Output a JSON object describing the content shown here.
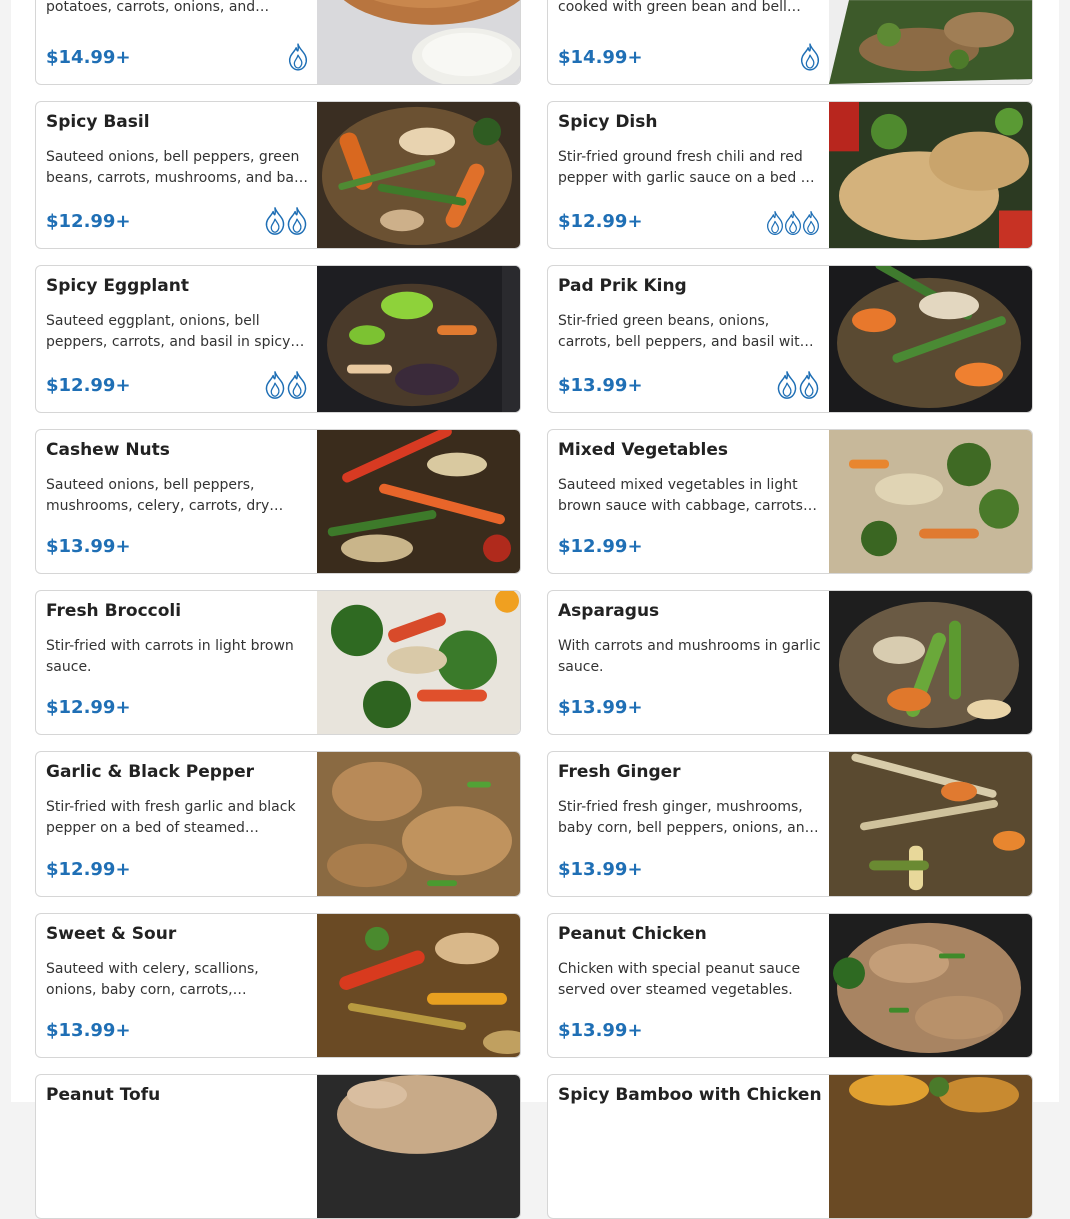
{
  "accent_color": "#1f6fb5",
  "items": [
    {
      "title": "",
      "desc": "potatoes, carrots, onions, and…",
      "price": "$14.99+",
      "spice": 1,
      "photo": "curry-with-rice"
    },
    {
      "title": "",
      "desc": "cooked with green bean and bell…",
      "price": "$14.99+",
      "spice": 1,
      "photo": "chicken-green-curry"
    },
    {
      "title": "Spicy Basil",
      "desc": "Sauteed onions, bell peppers, green beans, carrots, mushrooms, and ba…",
      "price": "$12.99+",
      "spice": 2,
      "photo": "spicy-basil"
    },
    {
      "title": "Spicy Dish",
      "desc": "Stir-fried ground fresh chili and red pepper with garlic sauce on a bed …",
      "price": "$12.99+",
      "spice": 3,
      "photo": "spicy-dish"
    },
    {
      "title": "Spicy Eggplant",
      "desc": "Sauteed eggplant, onions, bell peppers, carrots, and basil in spicy…",
      "price": "$12.99+",
      "spice": 2,
      "photo": "spicy-eggplant"
    },
    {
      "title": "Pad Prik King",
      "desc": "Stir-fried green beans, onions, carrots, bell peppers, and basil wit…",
      "price": "$13.99+",
      "spice": 2,
      "photo": "pad-prik-king"
    },
    {
      "title": "Cashew Nuts",
      "desc": "Sauteed onions, bell peppers, mushrooms, celery, carrots, dry…",
      "price": "$13.99+",
      "spice": 0,
      "photo": "cashew-nuts"
    },
    {
      "title": "Mixed Vegetables",
      "desc": "Sauteed mixed vegetables in light brown sauce with cabbage, carrots…",
      "price": "$12.99+",
      "spice": 0,
      "photo": "mixed-vegetables"
    },
    {
      "title": "Fresh Broccoli",
      "desc": "Stir-fried with carrots in light brown sauce.",
      "price": "$12.99+",
      "spice": 0,
      "photo": "fresh-broccoli"
    },
    {
      "title": "Asparagus",
      "desc": "With carrots and mushrooms in garlic sauce.",
      "price": "$13.99+",
      "spice": 0,
      "photo": "asparagus"
    },
    {
      "title": "Garlic & Black Pepper",
      "desc": "Stir-fried with fresh garlic and black pepper on a bed of steamed…",
      "price": "$12.99+",
      "spice": 0,
      "photo": "garlic-black-pepper"
    },
    {
      "title": "Fresh Ginger",
      "desc": "Stir-fried fresh ginger, mushrooms, baby corn, bell peppers, onions, an…",
      "price": "$13.99+",
      "spice": 0,
      "photo": "fresh-ginger"
    },
    {
      "title": "Sweet & Sour",
      "desc": "Sauteed with celery, scallions, onions, baby corn, carrots,…",
      "price": "$13.99+",
      "spice": 0,
      "photo": "sweet-sour"
    },
    {
      "title": "Peanut Chicken",
      "desc": "Chicken with special peanut sauce served over steamed vegetables.",
      "price": "$13.99+",
      "spice": 0,
      "photo": "peanut-chicken"
    },
    {
      "title": "Peanut Tofu",
      "desc": "",
      "price": "",
      "spice": 0,
      "photo": "peanut-tofu"
    },
    {
      "title": "Spicy Bamboo with Chicken",
      "desc": "",
      "price": "",
      "spice": 0,
      "photo": "spicy-bamboo"
    }
  ]
}
